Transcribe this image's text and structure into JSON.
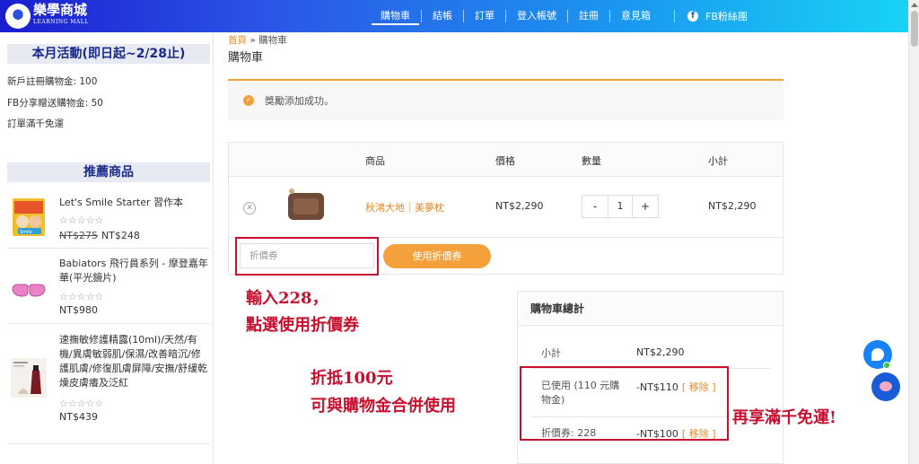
{
  "header": {
    "logo_text": "樂學商城",
    "logo_sub": "LEARNING MALL",
    "nav": [
      "購物車",
      "結帳",
      "訂單",
      "登入帳號",
      "註冊",
      "意見箱"
    ],
    "active_nav": "購物車",
    "fb_label": "FB粉絲團",
    "fb_icon": "facebook-icon",
    "gradient_colors": [
      "#1a1fd0",
      "#18d3f5"
    ]
  },
  "sidebar": {
    "promo_title": "本月活動(即日起~2/28止)",
    "promo_lines": [
      "新戶註冊購物金: 100",
      "FB分享贈送購物金: 50",
      "訂單滿千免運"
    ],
    "recommend_title": "推薦商品",
    "products": [
      {
        "name": "Let's Smile Starter 習作本",
        "stars": "☆☆☆☆☆",
        "old_price": "NT$275",
        "price": "NT$248"
      },
      {
        "name": "Babiators 飛行員系列 - 摩登嘉年華(平光鏡片)",
        "stars": "☆☆☆☆☆",
        "old_price": "",
        "price": "NT$980"
      },
      {
        "name": "速撫敏修護精露(10ml)/天然/有機/異膚敏弱肌/保濕/改善暗沉/修護肌膚/修復肌膚屏障/安撫/舒緩乾燥皮膚癢及泛紅",
        "stars": "☆☆☆☆☆",
        "old_price": "",
        "price": "NT$439"
      }
    ]
  },
  "main": {
    "breadcrumb_home": "首頁",
    "breadcrumb_sep": "»",
    "breadcrumb_current": "購物車",
    "heading": "購物車",
    "notice": "獎勵添加成功。",
    "table_headers": {
      "product": "商品",
      "price": "價格",
      "qty": "數量",
      "subtotal": "小計"
    },
    "cart_item": {
      "name": "秋鴻大地｜美夢枕",
      "price": "NT$2,290",
      "qty": "1",
      "subtotal": "NT$2,290"
    },
    "coupon_placeholder": "折價券",
    "coupon_button": "使用折價券",
    "totals": {
      "title": "購物車總計",
      "subtotal_label": "小計",
      "subtotal_value": "NT$2,290",
      "credit_label": "已使用 (110 元購物金)",
      "credit_value": "-NT$110",
      "coupon_label": "折價券: 228",
      "coupon_value": "-NT$100",
      "remove_label": "[ 移除 ]"
    }
  },
  "annotations": {
    "line1": "輸入228，",
    "line2": "點選使用折價券",
    "line3": "折抵100元",
    "line4": "可與購物金合併使用",
    "line5": "再享滿千免運!"
  },
  "colors": {
    "accent": "#f5a13b",
    "annotation": "#c8102e",
    "link": "#e08a2b",
    "title_blue": "#1a2a8a"
  }
}
